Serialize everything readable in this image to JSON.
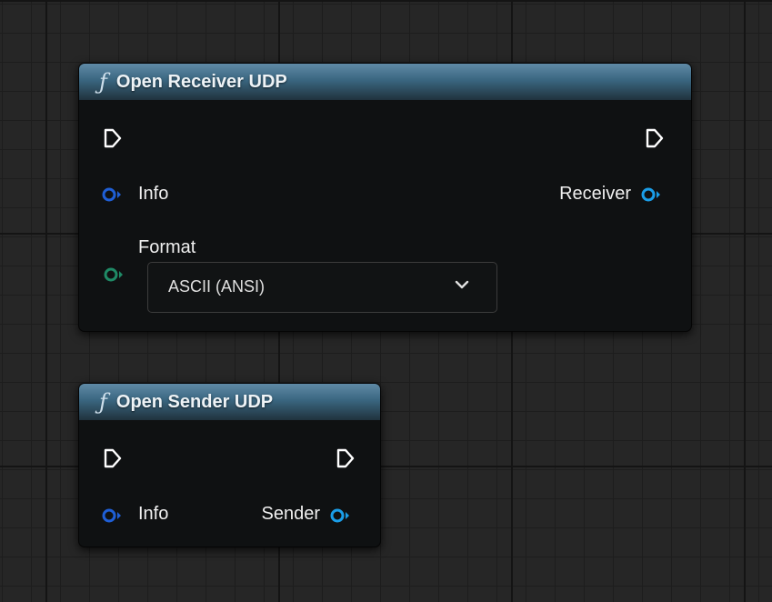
{
  "nodes": {
    "receiver": {
      "title": "Open Receiver UDP",
      "icon": "function-icon",
      "pins": {
        "info_label": "Info",
        "receiver_label": "Receiver",
        "format_label": "Format"
      },
      "format_selected": "ASCII (ANSI)"
    },
    "sender": {
      "title": "Open Sender UDP",
      "icon": "function-icon",
      "pins": {
        "info_label": "Info",
        "sender_label": "Sender"
      }
    }
  },
  "colors": {
    "struct_pin": "#1f5fd6",
    "object_pin": "#1a9ee8",
    "enum_pin": "#1f8a66",
    "exec_pin": "#ffffff",
    "header": "#3a6680"
  },
  "icon_glyphs": {
    "function": "ƒ"
  }
}
